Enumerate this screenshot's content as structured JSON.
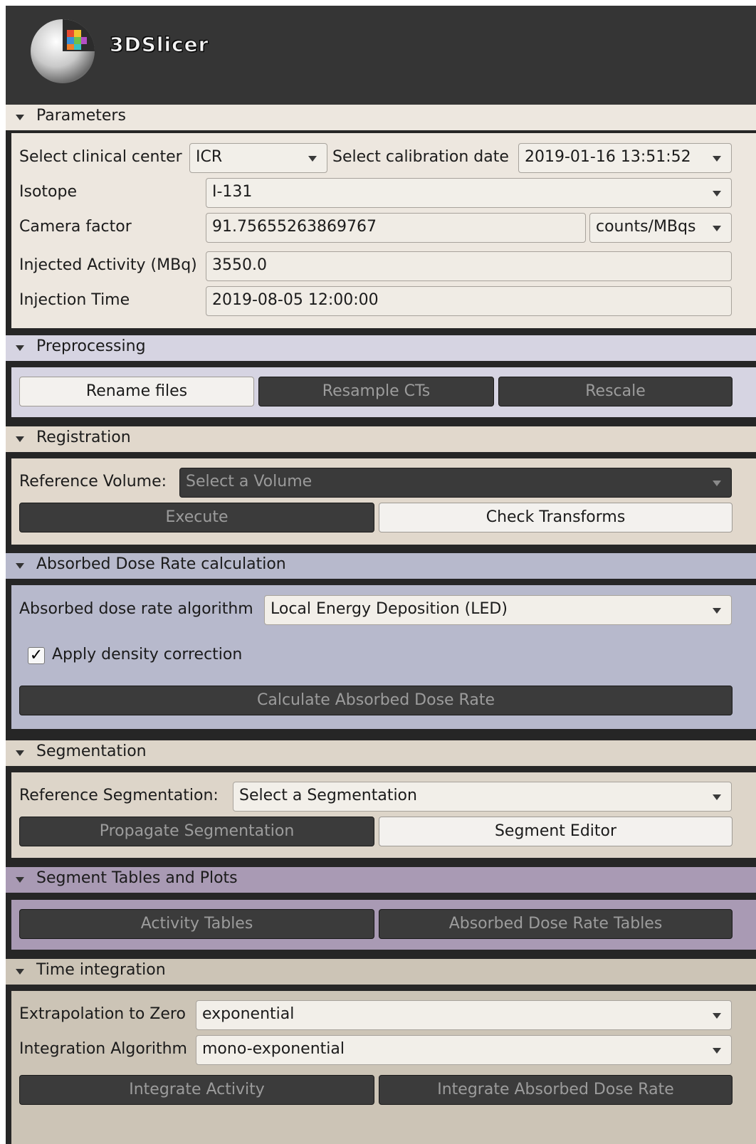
{
  "app": {
    "name": "3DSlicer"
  },
  "colors": {
    "parameters_bg": "#ede7df",
    "preprocessing_bg": "#d6d4e2",
    "registration_bg": "#e1d8cc",
    "dose_bg": "#b7b9cc",
    "segmentation_bg": "#ddd5c9",
    "tables_bg": "#a99ab4",
    "time_bg": "#ccc4b6"
  },
  "parameters": {
    "title": "Parameters",
    "clinical_center_label": "Select clinical center",
    "clinical_center_value": "ICR",
    "calibration_date_label": "Select calibration date",
    "calibration_date_value": "2019-01-16 13:51:52",
    "isotope_label": "Isotope",
    "isotope_value": "I-131",
    "camera_factor_label": "Camera factor",
    "camera_factor_value": "91.75655263869767",
    "camera_factor_unit": "counts/MBqs",
    "injected_activity_label": "Injected Activity (MBq)",
    "injected_activity_value": "3550.0",
    "injection_time_label": "Injection Time",
    "injection_time_value": "2019-08-05 12:00:00"
  },
  "preprocessing": {
    "title": "Preprocessing",
    "rename_files": "Rename files",
    "resample_cts": "Resample CTs",
    "rescale": "Rescale"
  },
  "registration": {
    "title": "Registration",
    "reference_volume_label": "Reference Volume:",
    "reference_volume_placeholder": "Select a Volume",
    "execute": "Execute",
    "check_transforms": "Check Transforms"
  },
  "dose_rate": {
    "title": "Absorbed Dose Rate calculation",
    "algorithm_label": "Absorbed dose rate algorithm",
    "algorithm_value": "Local Energy Deposition (LED)",
    "density_correction_label": "Apply density correction",
    "density_correction_checked": true,
    "check_glyph": "✓",
    "calculate": "Calculate Absorbed Dose Rate"
  },
  "segmentation": {
    "title": "Segmentation",
    "reference_label": "Reference Segmentation:",
    "reference_value": "Select a Segmentation",
    "propagate": "Propagate Segmentation",
    "editor": "Segment Editor"
  },
  "tables": {
    "title": "Segment Tables and Plots",
    "activity_tables": "Activity Tables",
    "dose_rate_tables": "Absorbed Dose Rate Tables"
  },
  "time_integration": {
    "title": "Time integration",
    "extrapolation_label": "Extrapolation to Zero",
    "extrapolation_value": "exponential",
    "algorithm_label": "Integration Algorithm",
    "algorithm_value": "mono-exponential",
    "integrate_activity": "Integrate Activity",
    "integrate_dose_rate": "Integrate Absorbed Dose Rate"
  }
}
